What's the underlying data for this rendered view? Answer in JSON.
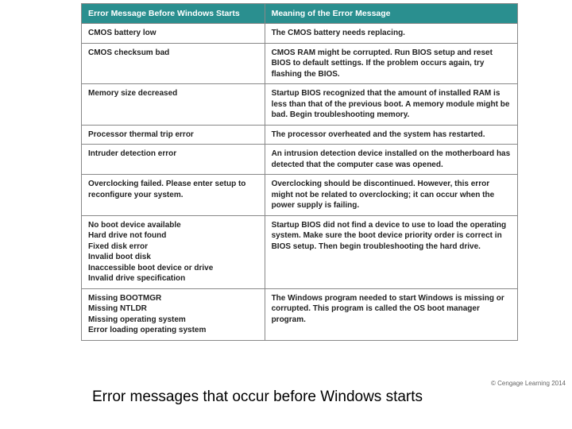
{
  "table": {
    "headers": {
      "col1": "Error Message Before Windows Starts",
      "col2": "Meaning of the Error Message"
    },
    "rows": [
      {
        "error": "CMOS battery low",
        "meaning": "The CMOS battery needs replacing."
      },
      {
        "error": "CMOS checksum bad",
        "meaning": "CMOS RAM might be corrupted. Run BIOS setup and reset BIOS to default settings. If the problem occurs again, try flashing the BIOS."
      },
      {
        "error": "Memory size decreased",
        "meaning": "Startup BIOS recognized that the amount of installed RAM is less than that of the previous boot. A memory module might be bad. Begin troubleshooting memory."
      },
      {
        "error": "Processor thermal trip error",
        "meaning": "The processor overheated and the system has restarted."
      },
      {
        "error": "Intruder detection error",
        "meaning": "An intrusion detection device installed on the motherboard has detected that the computer case was opened."
      },
      {
        "error": "Overclocking failed. Please enter setup to reconfigure your system.",
        "meaning": "Overclocking should be discontinued. However, this error might not be related to overclocking; it can occur when the power supply is failing."
      },
      {
        "error": "No boot device available\nHard drive not found\nFixed disk error\nInvalid boot disk\nInaccessible boot device or drive\nInvalid drive specification",
        "meaning": "Startup BIOS did not find a device to use to load the operating system. Make sure the boot device priority order is correct in BIOS setup. Then begin troubleshooting the hard drive."
      },
      {
        "error": "Missing BOOTMGR\nMissing NTLDR\nMissing operating system\nError loading operating system",
        "meaning": "The Windows program needed to start Windows is missing or corrupted. This program is called the OS boot manager program."
      }
    ]
  },
  "copyright": "© Cengage Learning 2014",
  "caption": "Error messages that occur before Windows starts"
}
